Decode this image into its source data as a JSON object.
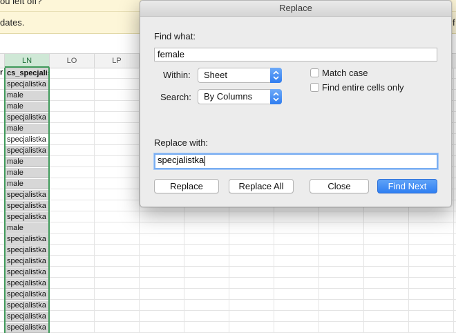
{
  "background": {
    "banner_line1": "ou left off?",
    "banner_line2": "dates.",
    "banner_right": "f"
  },
  "sheet": {
    "columns": [
      "LN",
      "LO",
      "LP"
    ],
    "selected_column": "LN",
    "row_prefix": "r",
    "header_cell": "cs_specjalista",
    "cells": [
      {
        "text": "specjalistka",
        "hl": true
      },
      {
        "text": "male",
        "hl": true
      },
      {
        "text": "male",
        "hl": true
      },
      {
        "text": "specjalistka",
        "hl": true
      },
      {
        "text": "male",
        "hl": true
      },
      {
        "text": "specjalistka",
        "hl": false
      },
      {
        "text": "specjalistka",
        "hl": true
      },
      {
        "text": "male",
        "hl": true
      },
      {
        "text": "male",
        "hl": true
      },
      {
        "text": "male",
        "hl": true
      },
      {
        "text": "specjalistka",
        "hl": true
      },
      {
        "text": "specjalistka",
        "hl": true
      },
      {
        "text": "specjalistka",
        "hl": true
      },
      {
        "text": "male",
        "hl": true
      },
      {
        "text": "specjalistka",
        "hl": true
      },
      {
        "text": "specjalistka",
        "hl": true
      },
      {
        "text": "specjalistka",
        "hl": true
      },
      {
        "text": "specjalistka",
        "hl": true
      },
      {
        "text": "specjalistka",
        "hl": true
      },
      {
        "text": "specjalistka",
        "hl": true
      },
      {
        "text": "specjalistka",
        "hl": true
      },
      {
        "text": "specjalistka",
        "hl": true
      },
      {
        "text": "specjalistka",
        "hl": true
      }
    ]
  },
  "dialog": {
    "title": "Replace",
    "find_label": "Find what:",
    "find_value": "female",
    "within_label": "Within:",
    "within_value": "Sheet",
    "search_label": "Search:",
    "search_value": "By Columns",
    "match_case_label": "Match case",
    "entire_cells_label": "Find entire cells only",
    "replace_label": "Replace with:",
    "replace_value": "specjalistka",
    "buttons": {
      "replace": "Replace",
      "replace_all": "Replace All",
      "close": "Close",
      "find_next": "Find Next"
    }
  },
  "colors": {
    "accent": "#2f7ff2",
    "selected_column": "#3f9a5a",
    "banner": "#fdf6d8"
  }
}
